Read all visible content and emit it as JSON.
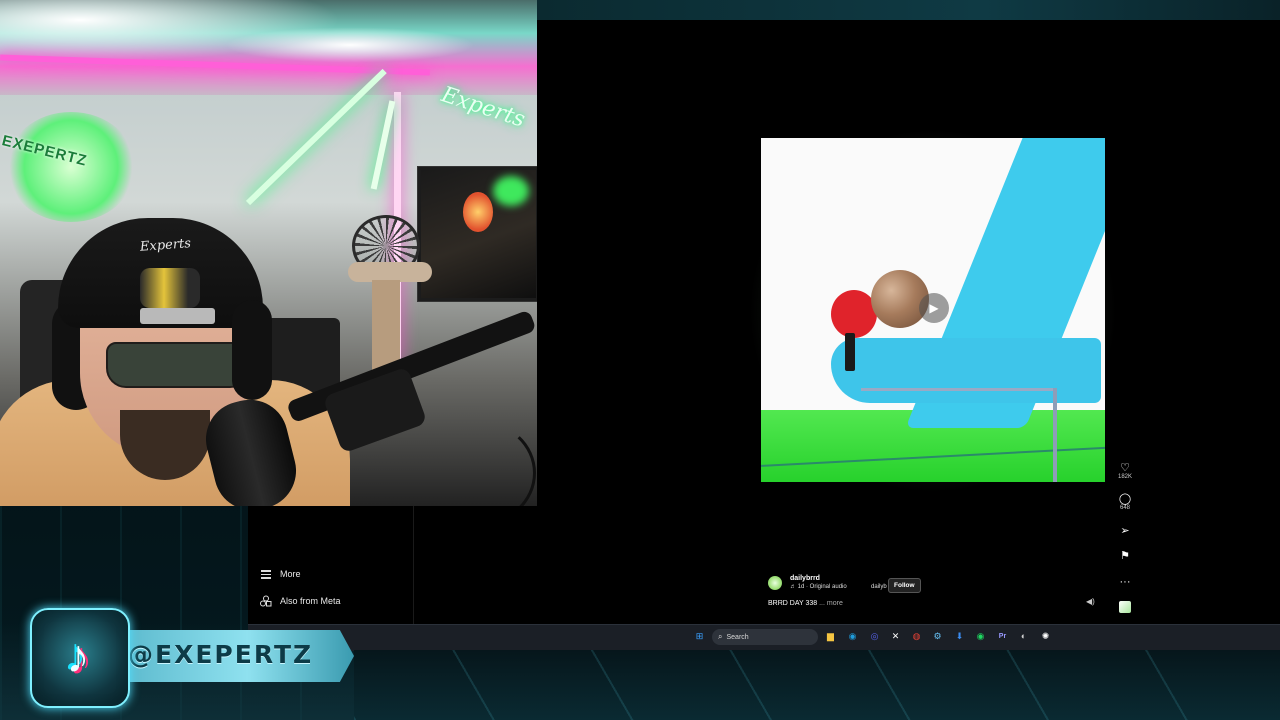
{
  "webcam": {
    "hat_text": "Experts",
    "wall_logo_text": "EXEPERTZ",
    "neon_sign_text": "Experts"
  },
  "sidebar": {
    "items": [
      {
        "label": "More",
        "icon": "hamburger-icon"
      },
      {
        "label": "Also from Meta",
        "icon": "meta-icon"
      }
    ]
  },
  "reel": {
    "username": "dailybrrd",
    "audio": "1d · Original audio",
    "audio_prefix": "♬",
    "secondary_user": "dailyb",
    "follow_label": "Follow",
    "caption": "BRRD DAY 338",
    "caption_more": "... more",
    "actions": [
      {
        "icon": "heart-icon",
        "glyph": "♡",
        "count": "182K"
      },
      {
        "icon": "comment-icon",
        "glyph": "◯",
        "count": "648"
      },
      {
        "icon": "share-icon",
        "glyph": "➢",
        "count": ""
      },
      {
        "icon": "bookmark-icon",
        "glyph": "⚑",
        "count": ""
      },
      {
        "icon": "more-icon",
        "glyph": "···",
        "count": ""
      }
    ]
  },
  "taskbar": {
    "search_placeholder": "Search",
    "apps": [
      {
        "name": "start-icon",
        "color": "#3aa0ff",
        "glyph": "⊞"
      },
      {
        "name": "file-explorer-icon",
        "color": "#f5c542",
        "glyph": "▆"
      },
      {
        "name": "edge-icon",
        "color": "#1f9cdb",
        "glyph": "◉"
      },
      {
        "name": "discord-icon",
        "color": "#5865f2",
        "glyph": "◎"
      },
      {
        "name": "capcut-icon",
        "color": "#ffffff",
        "glyph": "✕"
      },
      {
        "name": "chrome-icon",
        "color": "#e94235",
        "glyph": "◍"
      },
      {
        "name": "steam-icon",
        "color": "#66c0f4",
        "glyph": "⚙"
      },
      {
        "name": "download-icon",
        "color": "#3b8cf0",
        "glyph": "⬇"
      },
      {
        "name": "spotify-icon",
        "color": "#1ed760",
        "glyph": "◉"
      },
      {
        "name": "premiere-icon",
        "color": "#9999ff",
        "glyph": "Pr"
      },
      {
        "name": "obs-icon",
        "color": "#cfcfcf",
        "glyph": "◐"
      },
      {
        "name": "steelseries-icon",
        "color": "#ffffff",
        "glyph": "✺"
      }
    ]
  },
  "overlay": {
    "handle": "@EXEPERTZ",
    "platform_icon": "tiktok-icon"
  },
  "colors": {
    "accent_teal": "#4fe0ff",
    "neon_pink": "#ff5fd8",
    "neon_green": "#2cff7a",
    "floor_green": "#27d12c",
    "shape_blue": "#3ecbed",
    "paddle_red": "#e0232b"
  }
}
